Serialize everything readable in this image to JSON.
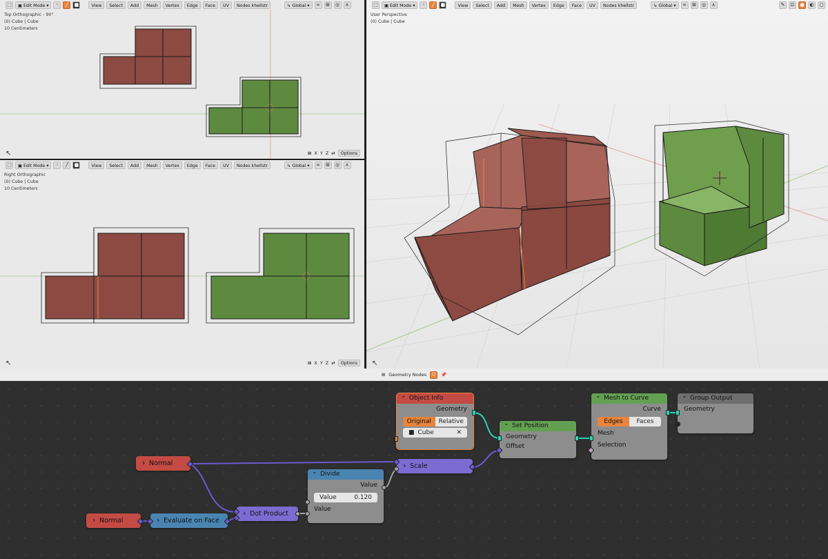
{
  "viewports": {
    "top": {
      "view_name": "Top Orthographic - 90°",
      "object": "(0) Cube | Cube",
      "scale": "10 Centimeters"
    },
    "right": {
      "view_name": "Right Orthographic",
      "object": "(0) Cube | Cube",
      "scale": "10 Centimeters"
    },
    "persp": {
      "view_name": "User Perspective",
      "object": "(0) Cube | Cube"
    }
  },
  "header": {
    "mode": "Edit Mode",
    "menus": [
      "View",
      "Select",
      "Add",
      "Mesh",
      "Vertex",
      "Edge",
      "Face",
      "UV",
      "Nodes khellstr"
    ],
    "transform_orientation": "Global"
  },
  "footer": {
    "axes": [
      "X",
      "Y",
      "Z"
    ],
    "options_label": "Options"
  },
  "node_editor": {
    "title": "Geometry Nodes",
    "nodes": {
      "object_info": {
        "title": "Object Info",
        "output": "Geometry",
        "modes": [
          "Original",
          "Relative"
        ],
        "active_mode": "Original",
        "object": "Cube"
      },
      "set_position": {
        "title": "Set Position",
        "inputs": [
          "Geometry",
          "Offset"
        ]
      },
      "mesh_to_curve": {
        "title": "Mesh to Curve",
        "output": "Curve",
        "modes": [
          "Edges",
          "Faces"
        ],
        "active_mode": "Edges",
        "inputs": [
          "Mesh",
          "Selection"
        ]
      },
      "group_output": {
        "title": "Group Output",
        "input": "Geometry"
      },
      "normal1": {
        "title": "Normal"
      },
      "normal2": {
        "title": "Normal"
      },
      "evaluate": {
        "title": "Evaluate on Face"
      },
      "dot": {
        "title": "Dot Product"
      },
      "scale": {
        "title": "Scale"
      },
      "divide": {
        "title": "Divide",
        "output": "Value",
        "field_label": "Value",
        "field_value": "0.120",
        "input": "Value"
      }
    }
  },
  "colors": {
    "red_mesh": "#8c4a42",
    "green_mesh": "#5d8a3f",
    "selected_edge": "#e8843c",
    "accent": "#e8843c"
  }
}
